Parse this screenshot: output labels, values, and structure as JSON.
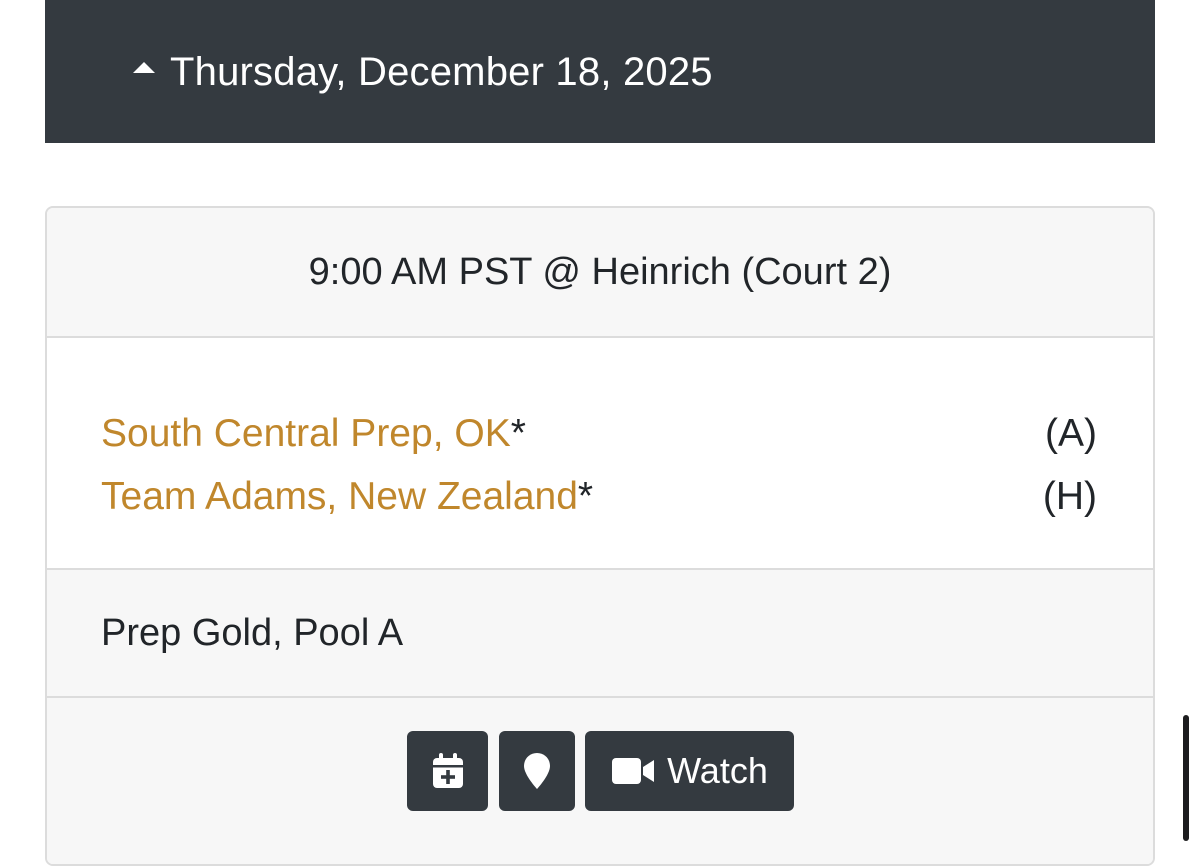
{
  "date_header": {
    "caret_icon": "caret-up-icon",
    "date": "Thursday, December 18, 2025"
  },
  "game": {
    "time_location": "9:00 AM PST @ Heinrich (Court 2)",
    "teams": [
      {
        "name": "South Central Prep, OK",
        "marker": "*",
        "side": "(A)"
      },
      {
        "name": "Team Adams, New Zealand",
        "marker": "*",
        "side": "(H)"
      }
    ],
    "pool": "Prep Gold, Pool A",
    "actions": {
      "calendar_icon": "calendar-plus-icon",
      "map_icon": "map-marker-icon",
      "watch_icon": "video-camera-icon",
      "watch_label": "Watch"
    }
  },
  "colors": {
    "header_bg": "#343a40",
    "team_link": "#c0872c",
    "card_bg": "#f7f7f7",
    "border": "#dcdcdc"
  }
}
